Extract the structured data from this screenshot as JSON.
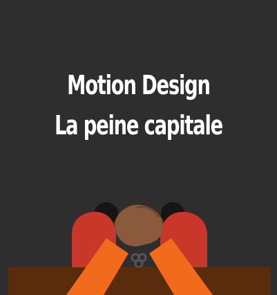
{
  "title": {
    "line1": "Motion Design",
    "line2": "La peine capitale"
  },
  "colors": {
    "background": "#2e2e2e",
    "title_text": "#ffffff",
    "jumpsuit_red": "#c9372b",
    "jumpsuit_orange": "#f26a1b",
    "skin": "#8b5a3c",
    "hair": "#1a1a1a",
    "table": "#5a2c0d",
    "cuffs": "#555555"
  },
  "icons": {
    "illustration": "handcuffed-prisoner-illustration"
  }
}
